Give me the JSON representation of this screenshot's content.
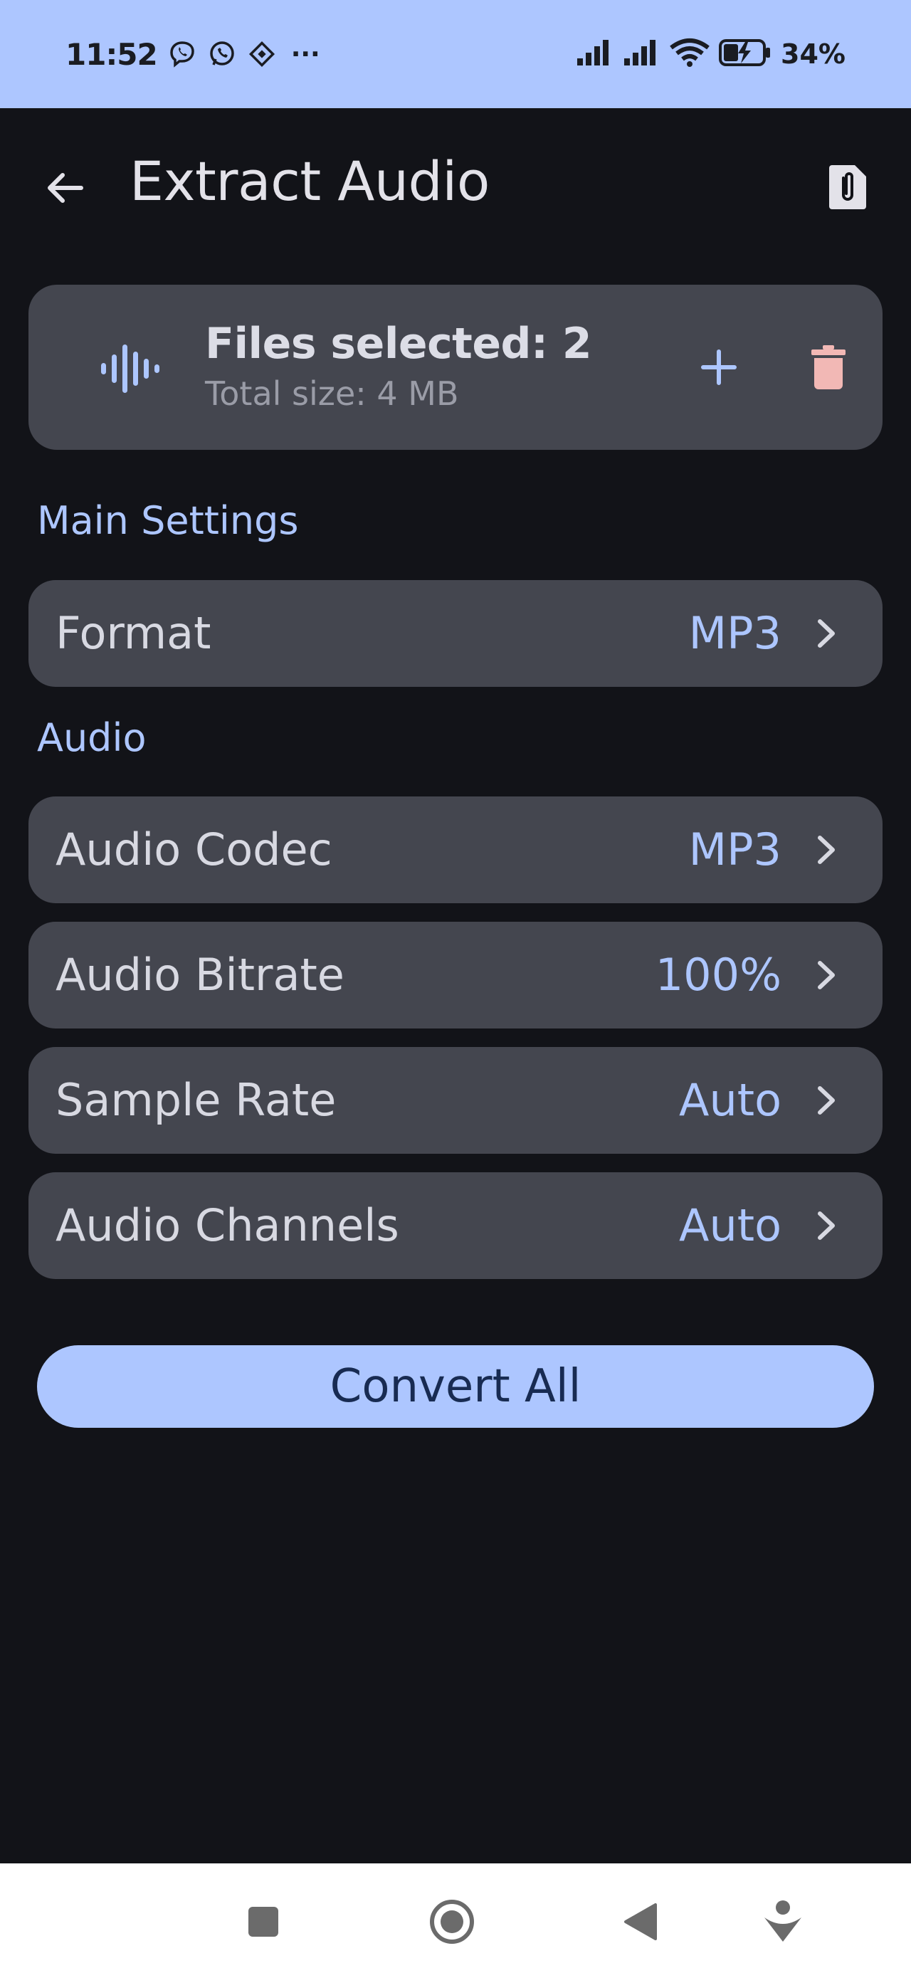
{
  "status_bar": {
    "time": "11:52",
    "notification_icons": [
      "viber-icon",
      "whatsapp-icon",
      "diamond-app-icon"
    ],
    "more_indicator": "···",
    "battery_percent": "34%",
    "background_color": "#adc6ff"
  },
  "app_bar": {
    "title": "Extract Audio",
    "back_icon": "arrow-back-icon",
    "action_icon": "file-attachment-icon"
  },
  "files_card": {
    "icon": "waveform-icon",
    "title": "Files selected: 2",
    "subtitle": "Total size: 4 MB",
    "add_icon": "plus-icon",
    "delete_icon": "trash-icon"
  },
  "sections": {
    "main_settings": "Main Settings",
    "audio": "Audio"
  },
  "main_settings": [
    {
      "label": "Format",
      "value": "MP3"
    }
  ],
  "audio_settings": [
    {
      "label": "Audio Codec",
      "value": "MP3"
    },
    {
      "label": "Audio Bitrate",
      "value": "100%"
    },
    {
      "label": "Sample Rate",
      "value": "Auto"
    },
    {
      "label": "Audio Channels",
      "value": "Auto"
    }
  ],
  "convert_button": {
    "label": "Convert All"
  },
  "nav_bar": {
    "buttons": [
      "recents-square-icon",
      "home-circle-icon",
      "back-triangle-icon",
      "assistant-icon"
    ]
  },
  "colors": {
    "background": "#121318",
    "card": "#44464f",
    "accent": "#adc6ff",
    "delete": "#f2b8b5",
    "text_primary": "#e3e2e9"
  }
}
